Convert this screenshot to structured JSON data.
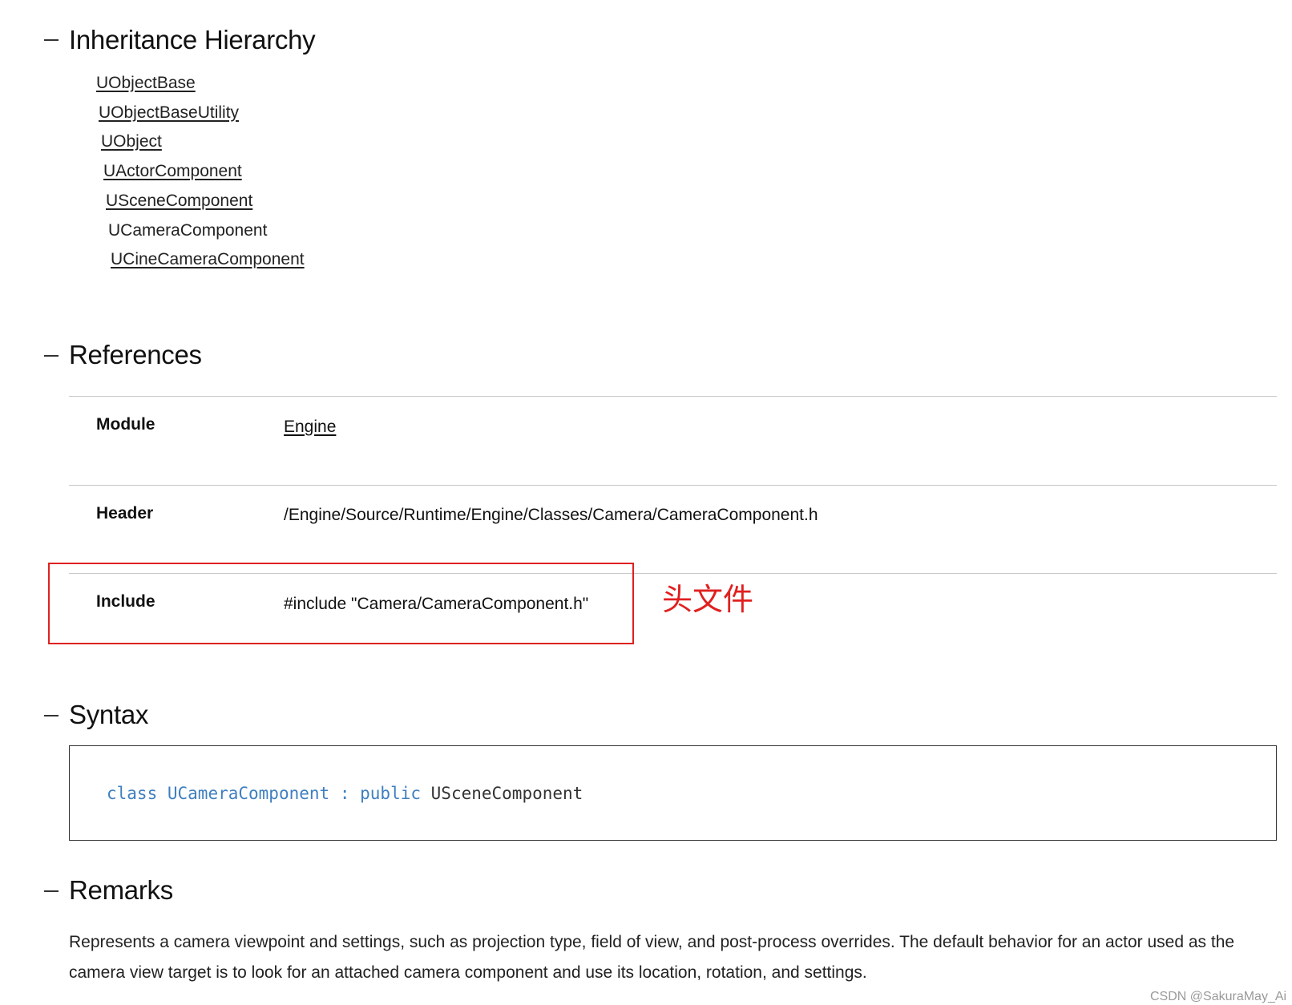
{
  "inheritance": {
    "title": "Inheritance Hierarchy",
    "items": [
      {
        "label": "UObjectBase",
        "link": true
      },
      {
        "label": "UObjectBaseUtility",
        "link": true
      },
      {
        "label": "UObject",
        "link": true
      },
      {
        "label": "UActorComponent",
        "link": true
      },
      {
        "label": "USceneComponent",
        "link": true
      },
      {
        "label": "UCameraComponent",
        "link": false
      },
      {
        "label": "UCineCameraComponent",
        "link": true
      }
    ]
  },
  "references": {
    "title": "References",
    "rows": [
      {
        "label": "Module",
        "value": "Engine"
      },
      {
        "label": "Header",
        "value": "/Engine/Source/Runtime/Engine/Classes/Camera/CameraComponent.h"
      },
      {
        "label": "Include",
        "value": "#include \"Camera/CameraComponent.h\""
      }
    ],
    "annotation": "头文件"
  },
  "syntax": {
    "title": "Syntax",
    "kw_class": "class",
    "class_name": "UCameraComponent",
    "colon": ":",
    "kw_public": "public",
    "base": "USceneComponent"
  },
  "remarks": {
    "title": "Remarks",
    "text": "Represents a camera viewpoint and settings, such as projection type, field of view, and post-process overrides. The default behavior for an actor used as the camera view target is to look for an attached camera component and use its location, rotation, and settings."
  },
  "watermark": "CSDN @SakuraMay_Ai",
  "colors": {
    "annotation_red": "#e02020",
    "code_keyword": "#3f7fbf"
  }
}
